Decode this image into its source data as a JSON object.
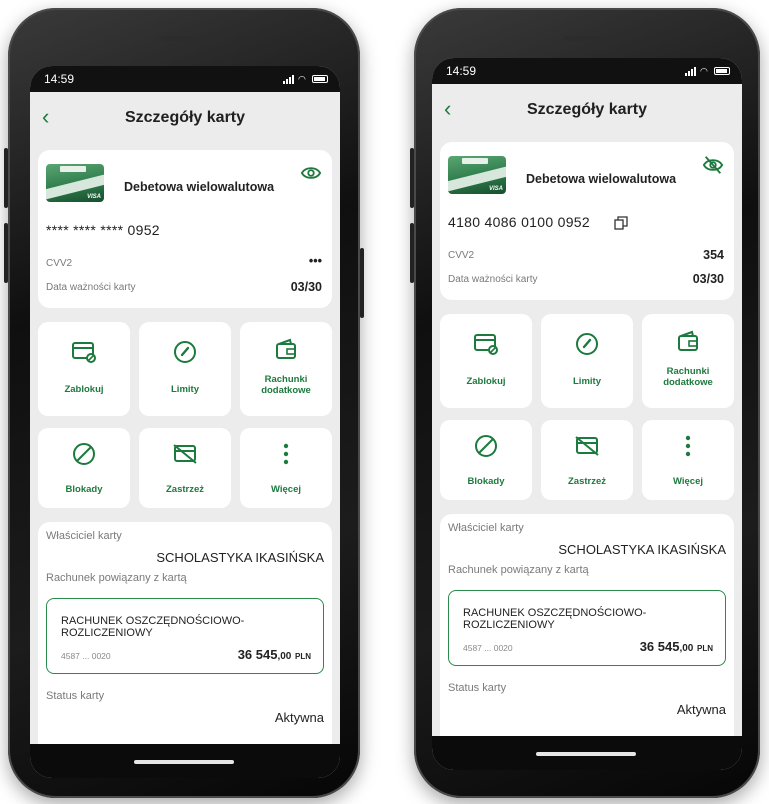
{
  "colors": {
    "accent": "#1d7a3e",
    "background": "#ececec",
    "card": "#ffffff"
  },
  "phones": [
    {
      "status_time": "14:59",
      "title": "Szczegóły karty",
      "card_name": "Debetowa wielowalutowa",
      "card_number": "**** **** **** 0952",
      "card_number_copy_icon": false,
      "eye_state": "visible-eye-icon",
      "cvv_label": "CVV2",
      "cvv_value": "•••",
      "expiry_label": "Data ważności karty",
      "expiry_value": "03/30",
      "actions": [
        {
          "label": "Zablokuj",
          "icon": "card-lock-icon"
        },
        {
          "label": "Limity",
          "icon": "gauge-icon"
        },
        {
          "label": "Rachunki dodatkowe",
          "icon": "wallet-icon"
        },
        {
          "label": "Blokady",
          "icon": "block-icon"
        },
        {
          "label": "Zastrzeż",
          "icon": "card-cancel-icon"
        },
        {
          "label": "Więcej",
          "icon": "more-vertical-icon"
        }
      ],
      "owner_label": "Właściciel karty",
      "owner_value": "SCHOLASTYKA IKASIŃSKA",
      "linked_label": "Rachunek powiązany z kartą",
      "account_name_line1": "RACHUNEK OSZCZĘDNOŚCIOWO-",
      "account_name_line2": "ROZLICZENIOWY",
      "account_number": "4587 ... 0020",
      "account_balance": "36 545",
      "account_balance_dec": ",00",
      "account_currency": "PLN",
      "status_label": "Status karty",
      "status_value": "Aktywna"
    },
    {
      "status_time": "14:59",
      "title": "Szczegóły karty",
      "card_name": "Debetowa wielowalutowa",
      "card_number": "4180 4086 0100 0952",
      "card_number_copy_icon": true,
      "eye_state": "eye-off-icon",
      "cvv_label": "CVV2",
      "cvv_value": "354",
      "expiry_label": "Data ważności karty",
      "expiry_value": "03/30",
      "actions": [
        {
          "label": "Zablokuj",
          "icon": "card-lock-icon"
        },
        {
          "label": "Limity",
          "icon": "gauge-icon"
        },
        {
          "label": "Rachunki dodatkowe",
          "icon": "wallet-icon"
        },
        {
          "label": "Blokady",
          "icon": "block-icon"
        },
        {
          "label": "Zastrzeż",
          "icon": "card-cancel-icon"
        },
        {
          "label": "Więcej",
          "icon": "more-vertical-icon"
        }
      ],
      "owner_label": "Właściciel karty",
      "owner_value": "SCHOLASTYKA IKASIŃSKA",
      "linked_label": "Rachunek powiązany z kartą",
      "account_name_line1": "RACHUNEK OSZCZĘDNOŚCIOWO-",
      "account_name_line2": "ROZLICZENIOWY",
      "account_number": "4587 ... 0020",
      "account_balance": "36 545",
      "account_balance_dec": ",00",
      "account_currency": "PLN",
      "status_label": "Status karty",
      "status_value": "Aktywna"
    }
  ]
}
